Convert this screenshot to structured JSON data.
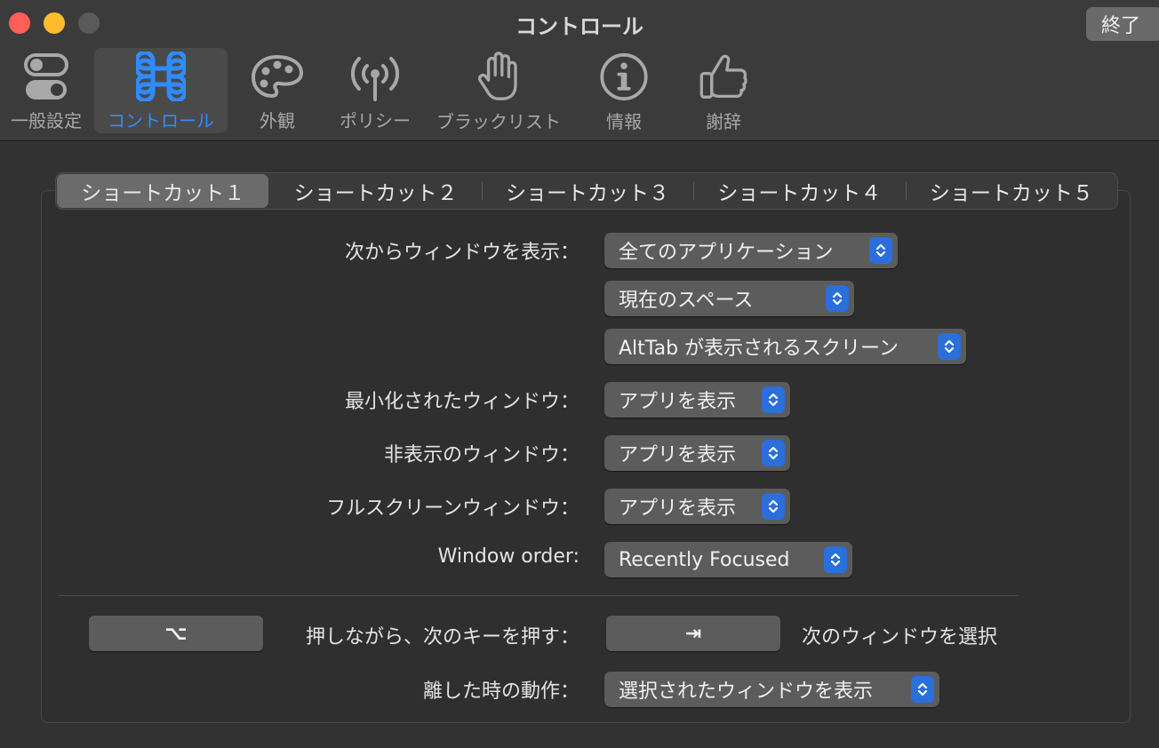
{
  "window": {
    "title": "コントロール",
    "quit_label": "終了"
  },
  "toolbar": {
    "items": [
      {
        "label": "一般設定",
        "icon": "toggle-switches-icon"
      },
      {
        "label": "コントロール",
        "icon": "command-key-icon"
      },
      {
        "label": "外観",
        "icon": "palette-icon"
      },
      {
        "label": "ポリシー",
        "icon": "antenna-icon"
      },
      {
        "label": "ブラックリスト",
        "icon": "hand-icon"
      },
      {
        "label": "情報",
        "icon": "info-icon"
      },
      {
        "label": "謝辞",
        "icon": "thumbs-up-icon"
      }
    ],
    "active_color": "#2f8cff"
  },
  "tabs": [
    "ショートカット１",
    "ショートカット２",
    "ショートカット３",
    "ショートカット４",
    "ショートカット５"
  ],
  "form": {
    "show_windows_from_label": "次からウィンドウを表示：",
    "apps_value": "全てのアプリケーション",
    "spaces_value": "現在のスペース",
    "screens_value": "AltTab が表示されるスクリーン",
    "minimized_label": "最小化されたウィンドウ：",
    "minimized_value": "アプリを表示",
    "hidden_label": "非表示のウィンドウ：",
    "hidden_value": "アプリを表示",
    "fullscreen_label": "フルスクリーンウィンドウ：",
    "fullscreen_value": "アプリを表示",
    "order_label": "Window order:",
    "order_value": "Recently Focused",
    "hold_key": "⌥",
    "hold_label": "押しながら、次のキーを押す：",
    "next_key": "⇥",
    "next_label": "次のウィンドウを選択",
    "release_label": "離した時の動作：",
    "release_value": "選択されたウィンドウを表示"
  },
  "accent": "#2a6fdb"
}
